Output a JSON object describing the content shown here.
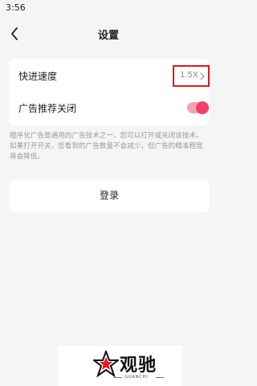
{
  "status_bar": {
    "time": "3:56"
  },
  "nav": {
    "title": "设置",
    "back_icon": "chevron-left-icon"
  },
  "settings": {
    "speed": {
      "label": "快进速度",
      "value": "1.5X",
      "icon": "chevron-right-icon",
      "highlight_color": "#e0191e"
    },
    "ads": {
      "label": "广告推荐关闭",
      "toggle_on": true,
      "toggle_color": "#f24069"
    }
  },
  "description": "程序化广告是通用的广告技术之一，您可以打开或关闭该技术。如果打开开关，您看到的广告数量不会减少，但广告的精准程度将会降低。",
  "login": {
    "label": "登录"
  },
  "watermark": {
    "brand": "观驰",
    "sub": "GUANCHI"
  }
}
